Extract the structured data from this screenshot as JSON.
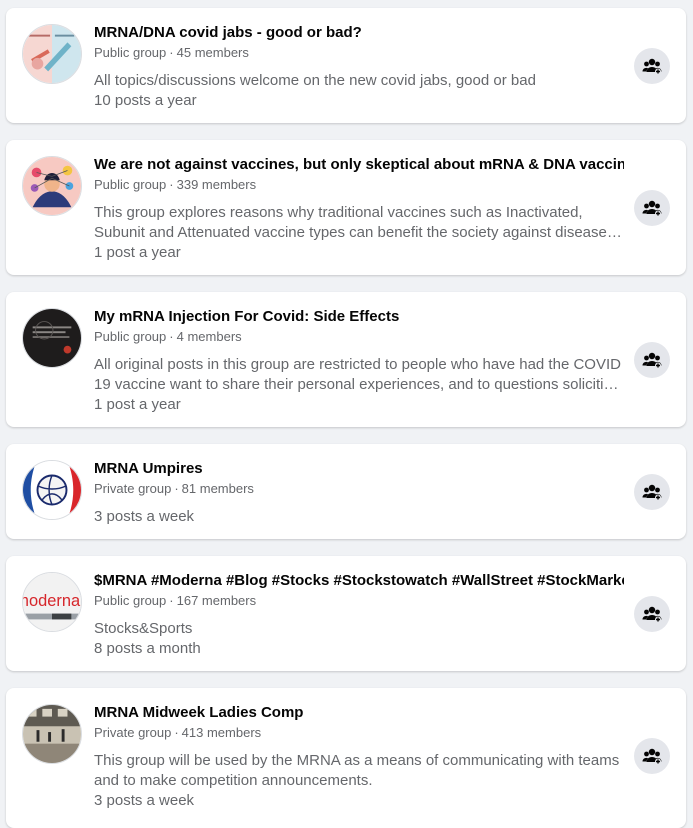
{
  "groups": [
    {
      "name": "MRNA/DNA covid jabs - good or bad?",
      "privacy": "Public group",
      "members": "45 members",
      "description": "All topics/discussions welcome on the new covid jabs, good or bad",
      "activity": "10 posts a year"
    },
    {
      "name": "We are not against vaccines, but only skeptical about mRNA & DNA vaccines",
      "privacy": "Public group",
      "members": "339 members",
      "description": "This group explores reasons why traditional vaccines such as Inactivated, Subunit and Attenuated vaccine types can benefit the society against diseases. Comparing them against the new mRNA and DNA vaccine technologies.",
      "activity": "1 post a year"
    },
    {
      "name": "My mRNA Injection For Covid: Side Effects",
      "privacy": "Public group",
      "members": "4 members",
      "description": "All original posts in this group are restricted to people who have had the COVID 19 vaccine want to share their personal experiences, and to questions soliciting such experiences.",
      "activity": "1 post a year"
    },
    {
      "name": "MRNA Umpires",
      "privacy": "Private group",
      "members": "81 members",
      "description": "",
      "activity": "3 posts a week"
    },
    {
      "name": "$MRNA #Moderna #Blog #Stocks #Stockstowatch #WallStreet #StockMarket",
      "privacy": "Public group",
      "members": "167 members",
      "description": "Stocks&Sports",
      "activity": "8 posts a month"
    },
    {
      "name": "MRNA Midweek Ladies Comp",
      "privacy": "Private group",
      "members": "413 members",
      "description": "This group will be used by the MRNA as a means of communicating with teams and to make competition announcements.",
      "activity": "3 posts a week"
    }
  ],
  "avatar_texts": {
    "moderna": "moderna"
  },
  "icons": {
    "join": "join-group-icon"
  }
}
